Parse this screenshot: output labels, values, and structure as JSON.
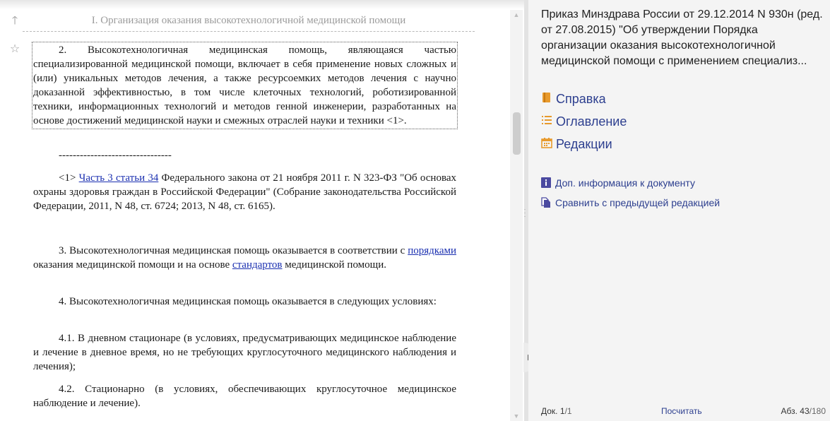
{
  "section_heading": "I. Организация оказания высокотехнологичной медицинской помощи",
  "gutter": {
    "up_icon": "arrow-up-icon",
    "star_icon": "star-outline-icon"
  },
  "doc": {
    "p2": "2. Высокотехнологичная медицинская помощь, являющаяся частью специализированной медицинской помощи, включает в себя применение новых сложных и (или) уникальных методов лечения, а также ресурсоемких методов лечения с научно доказанной эффективностью, в том числе клеточных технологий, роботизированной техники, информационных технологий и методов генной инженерии, разработанных на основе достижений медицинской науки и смежных отраслей науки и техники <1>.",
    "separator": "--------------------------------",
    "footnote_prefix": "<1> ",
    "footnote_link": "Часть 3 статьи 34",
    "footnote_rest": " Федерального закона от 21 ноября 2011 г. N 323-ФЗ \"Об основах охраны здоровья граждан в Российской Федерации\" (Собрание законодательства Российской Федерации, 2011, N 48, ст. 6724; 2013, N 48, ст. 6165).",
    "p3_a": "3. Высокотехнологичная медицинская помощь оказывается в соответствии с ",
    "p3_link1": "порядками",
    "p3_b": " оказания медицинской помощи и на основе ",
    "p3_link2": "стандартов",
    "p3_c": " медицинской помощи.",
    "p4": "4. Высокотехнологичная медицинская помощь оказывается в следующих условиях:",
    "p41": "4.1. В дневном стационаре (в условиях, предусматривающих медицинское наблюдение и лечение в дневное время, но не требующих круглосуточного медицинского наблюдения и лечения);",
    "p42": "4.2. Стационарно (в условиях, обеспечивающих круглосуточное медицинское наблюдение и лечение)."
  },
  "panel": {
    "title": "Приказ Минздрава России от 29.12.2014 N 930н (ред. от 27.08.2015) \"Об утверждении Порядка организации оказания высокотехнологичной медицинской помощи с применением специализ...",
    "nav": [
      {
        "label": "Справка",
        "icon": "book-icon"
      },
      {
        "label": "Оглавление",
        "icon": "list-icon"
      },
      {
        "label": "Редакции",
        "icon": "calendar-icon"
      }
    ],
    "links": [
      {
        "label": "Доп. информация к документу",
        "icon": "info-icon"
      },
      {
        "label": "Сравнить с предыдущей редакцией",
        "icon": "compare-docs-icon"
      }
    ]
  },
  "status": {
    "doc_label": "Док.",
    "doc_current": "1",
    "doc_total": "/1",
    "count_link": "Посчитать",
    "abz_label": "Абз.",
    "abz_current": "43",
    "abz_total": "/180"
  },
  "colors": {
    "link": "#1a2fb0",
    "panel_link": "#2d3f8f",
    "icon_orange": "#e89a2c",
    "icon_info": "#4b4aa0"
  }
}
